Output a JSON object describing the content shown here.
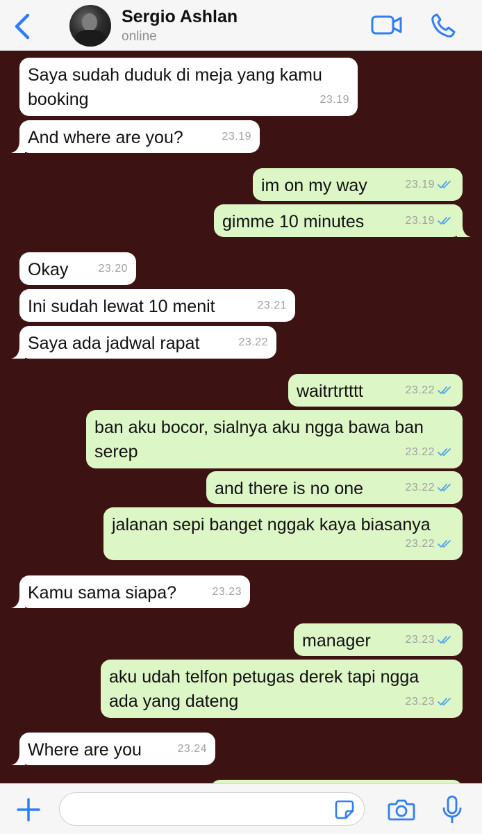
{
  "header": {
    "contact_name": "Sergio Ashlan",
    "status": "online"
  },
  "messages": [
    {
      "dir": "in",
      "text": "Saya sudah duduk di meja yang kamu\nbooking",
      "time": "23.19"
    },
    {
      "dir": "in",
      "text": "And where are you?",
      "time": "23.19"
    },
    {
      "dir": "out",
      "text": "im on my way",
      "time": "23.19"
    },
    {
      "dir": "out",
      "text": "gimme 10 minutes",
      "time": "23.19"
    },
    {
      "dir": "in",
      "text": "Okay",
      "time": "23.20"
    },
    {
      "dir": "in",
      "text": "Ini sudah lewat 10 menit",
      "time": "23.21"
    },
    {
      "dir": "in",
      "text": "Saya ada jadwal rapat",
      "time": "23.22"
    },
    {
      "dir": "out",
      "text": "waitrtrtttt",
      "time": "23.22"
    },
    {
      "dir": "out",
      "text": "ban aku bocor, sialnya aku ngga bawa ban\nserep",
      "time": "23.22"
    },
    {
      "dir": "out",
      "text": "and there is no one",
      "time": "23.22"
    },
    {
      "dir": "out",
      "text": "jalanan sepi banget nggak kaya biasanya",
      "time": "23.22"
    },
    {
      "dir": "in",
      "text": "Kamu sama siapa?",
      "time": "23.23"
    },
    {
      "dir": "out",
      "text": "manager",
      "time": "23.23"
    },
    {
      "dir": "out",
      "text": "aku udah telfon petugas derek tapi ngga\nada yang dateng",
      "time": "23.23"
    },
    {
      "dir": "in",
      "text": "Where are you",
      "time": "23.24"
    }
  ],
  "input": {
    "value": "",
    "placeholder": ""
  },
  "colors": {
    "chat_background": "#3d1212",
    "incoming_bubble": "#ffffff",
    "outgoing_bubble": "#dcf6c6",
    "accent": "#2f7ef6",
    "read_ticks": "#4fa6e8"
  },
  "icons": [
    "chevron-left-icon",
    "video-camera-icon",
    "phone-icon",
    "plus-icon",
    "sticker-icon",
    "camera-icon",
    "microphone-icon",
    "double-check-icon"
  ]
}
